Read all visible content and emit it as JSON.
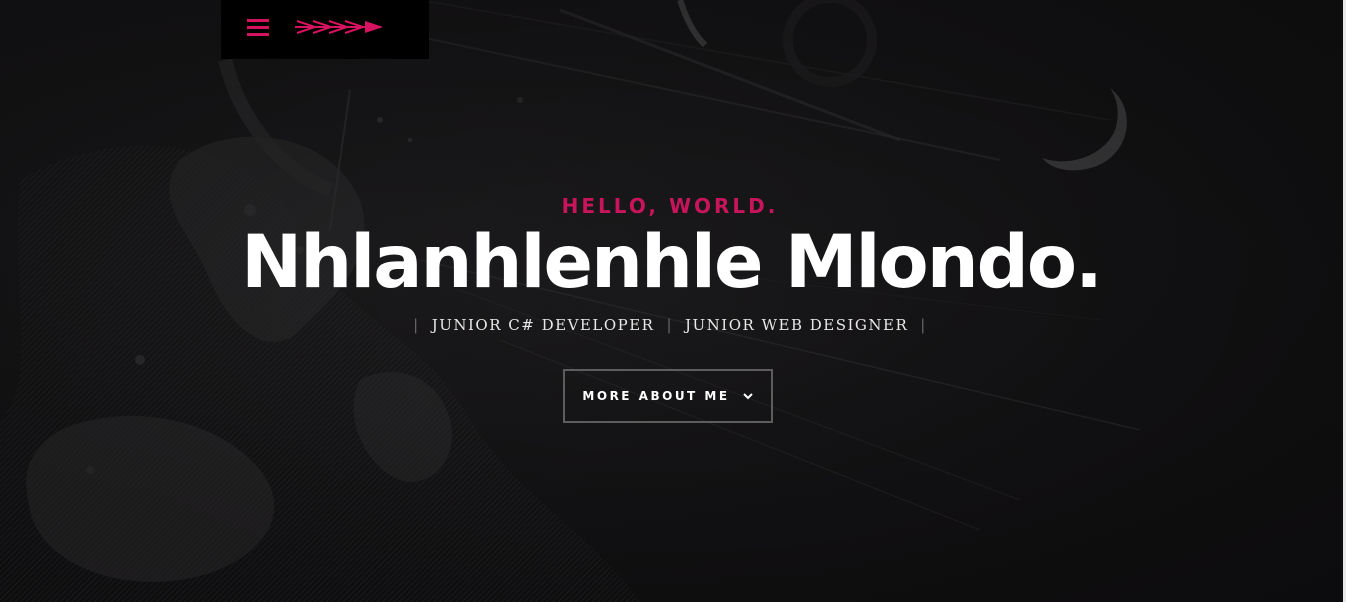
{
  "header": {
    "menu_icon": "hamburger-menu-icon",
    "logo_icon": "arrow-logo-icon"
  },
  "intro": {
    "greeting": "HELLO, WORLD.",
    "name": "Nhlanhlenhle Mlondo.",
    "roles": [
      "JUNIOR C# DEVELOPER",
      "JUNIOR WEB DESIGNER"
    ],
    "separator": "|",
    "cta_label": "MORE ABOUT ME",
    "cta_icon": "chevron-down-icon"
  },
  "colors": {
    "accent": "#c8145a",
    "background": "#121113",
    "text": "#ffffff"
  }
}
